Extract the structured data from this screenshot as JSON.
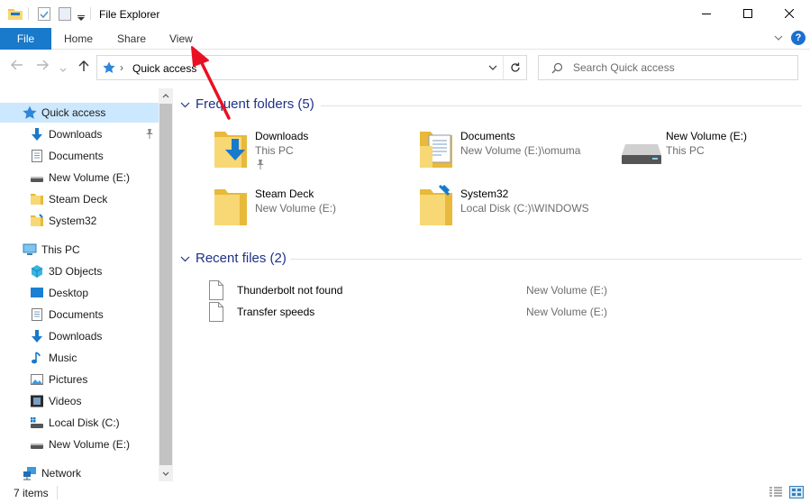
{
  "window": {
    "title": "File Explorer",
    "minimize_icon": "minimize-icon",
    "maximize_icon": "maximize-icon",
    "close_icon": "close-icon"
  },
  "quick_access_toolbar": [
    "folder-icon",
    "properties-icon",
    "new-folder-icon",
    "customize-dropdown-icon"
  ],
  "ribbon": {
    "tabs": [
      {
        "label": "File",
        "active": true
      },
      {
        "label": "Home"
      },
      {
        "label": "Share"
      },
      {
        "label": "View"
      }
    ],
    "help_label": "?"
  },
  "address_bar": {
    "separator": "›",
    "location": "Quick access",
    "search_placeholder": "Search Quick access"
  },
  "nav_pane": {
    "items": [
      {
        "label": "Quick access",
        "icon": "star-icon",
        "selected": true,
        "pinned": false
      },
      {
        "label": "Downloads",
        "icon": "downloads-icon",
        "pinned": true
      },
      {
        "label": "Documents",
        "icon": "documents-icon"
      },
      {
        "label": "New Volume (E:)",
        "icon": "drive-icon"
      },
      {
        "label": "Steam Deck",
        "icon": "folder-icon"
      },
      {
        "label": "System32",
        "icon": "system-folder-icon"
      },
      {
        "label": "This PC",
        "icon": "pc-icon"
      },
      {
        "label": "3D Objects",
        "icon": "3d-objects-icon"
      },
      {
        "label": "Desktop",
        "icon": "desktop-icon"
      },
      {
        "label": "Documents",
        "icon": "documents-icon"
      },
      {
        "label": "Downloads",
        "icon": "downloads-icon"
      },
      {
        "label": "Music",
        "icon": "music-icon"
      },
      {
        "label": "Pictures",
        "icon": "pictures-icon"
      },
      {
        "label": "Videos",
        "icon": "videos-icon"
      },
      {
        "label": "Local Disk (C:)",
        "icon": "windows-drive-icon"
      },
      {
        "label": "New Volume (E:)",
        "icon": "drive-icon"
      },
      {
        "label": "Network",
        "icon": "network-icon"
      }
    ]
  },
  "frequent_folders": {
    "header": "Frequent folders (5)",
    "items": [
      {
        "name": "Downloads",
        "location": "This PC",
        "icon": "downloads-folder-icon",
        "pinned": true
      },
      {
        "name": "Documents",
        "location": "New Volume (E:)\\omuma",
        "icon": "documents-folder-icon"
      },
      {
        "name": "New Volume (E:)",
        "location": "This PC",
        "icon": "drive-icon"
      },
      {
        "name": "Steam Deck",
        "location": "New Volume (E:)",
        "icon": "folder-icon"
      },
      {
        "name": "System32",
        "location": "Local Disk (C:)\\WINDOWS",
        "icon": "system-folder-icon"
      }
    ]
  },
  "recent_files": {
    "header": "Recent files (2)",
    "items": [
      {
        "name": "Thunderbolt not found",
        "location": "New Volume (E:)",
        "icon": "file-icon"
      },
      {
        "name": "Transfer speeds",
        "location": "New Volume (E:)",
        "icon": "file-icon"
      }
    ]
  },
  "status_bar": {
    "count": "7 items",
    "views": [
      "details-view-icon",
      "large-icons-view-icon"
    ]
  },
  "annotation": {
    "icon": "red-arrow-pointing-to-view-tab",
    "color": "#e81123"
  },
  "colors": {
    "accent": "#1979ca",
    "header_blue": "#1e3287",
    "selection": "#cce8ff"
  }
}
